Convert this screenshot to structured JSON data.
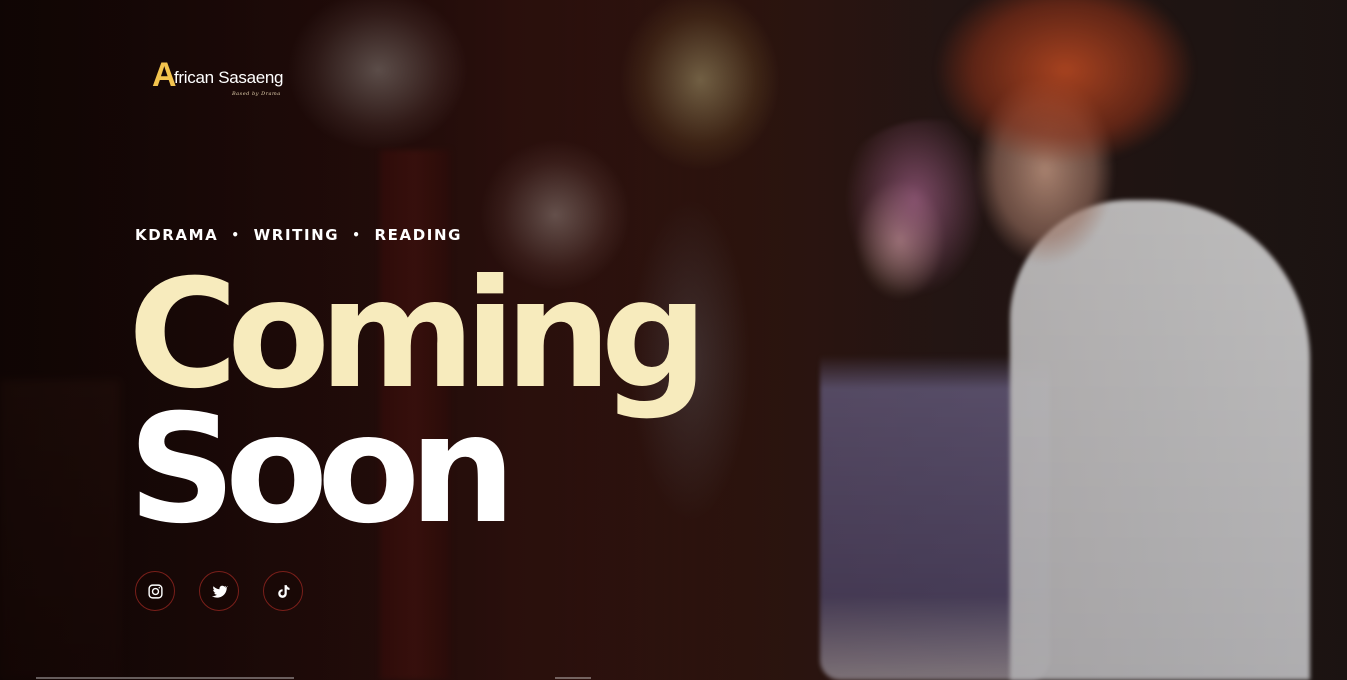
{
  "brand": {
    "logo_mark": "A",
    "logo_text": "frican Sasaeng",
    "tagline": "Based by Drama",
    "accent_color": "#f3c44e"
  },
  "categories": [
    "KDRAMA",
    "WRITING",
    "READING"
  ],
  "separator": "•",
  "heading": {
    "line1": "Coming",
    "line2": "Soon",
    "line1_color": "#f7ebbd",
    "line2_color": "#ffffff"
  },
  "socials": [
    {
      "name": "instagram",
      "icon": "instagram-icon"
    },
    {
      "name": "twitter",
      "icon": "twitter-icon"
    },
    {
      "name": "tiktok",
      "icon": "tiktok-icon"
    }
  ]
}
